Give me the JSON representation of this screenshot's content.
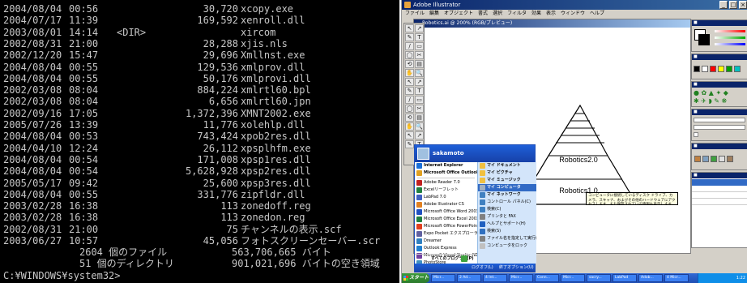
{
  "console": {
    "rows": [
      {
        "date": "2004/08/04",
        "time": "00:56",
        "size": "30,720",
        "name": "xcopy.exe"
      },
      {
        "date": "2004/07/17",
        "time": "11:39",
        "size": "169,592",
        "name": "xenroll.dll"
      },
      {
        "date": "2003/08/01",
        "time": "14:14",
        "dir": "<DIR>",
        "size": "",
        "name": "xircom"
      },
      {
        "date": "2002/08/31",
        "time": "21:00",
        "size": "28,288",
        "name": "xjis.nls"
      },
      {
        "date": "2002/12/20",
        "time": "15:47",
        "size": "29,696",
        "name": "Xmllnst.exe"
      },
      {
        "date": "2004/08/04",
        "time": "00:55",
        "size": "129,536",
        "name": "xmlprov.dll"
      },
      {
        "date": "2004/08/04",
        "time": "00:55",
        "size": "50,176",
        "name": "xmlprovi.dll"
      },
      {
        "date": "2002/03/08",
        "time": "08:04",
        "size": "884,224",
        "name": "xmlrtl60.bpl"
      },
      {
        "date": "2002/03/08",
        "time": "08:04",
        "size": "6,656",
        "name": "xmlrtl60.jpn"
      },
      {
        "date": "2002/09/16",
        "time": "17:05",
        "size": "1,372,396",
        "name": "XMNT2002.exe"
      },
      {
        "date": "2005/07/26",
        "time": "13:39",
        "size": "11,776",
        "name": "xolehlp.dll"
      },
      {
        "date": "2004/08/04",
        "time": "00:53",
        "size": "743,424",
        "name": "xpob2res.dll"
      },
      {
        "date": "2004/04/10",
        "time": "12:24",
        "size": "26,112",
        "name": "xpsplhfm.exe"
      },
      {
        "date": "2004/08/04",
        "time": "00:54",
        "size": "171,008",
        "name": "xpsp1res.dll"
      },
      {
        "date": "2004/08/04",
        "time": "00:54",
        "size": "5,628,928",
        "name": "xpsp2res.dll"
      },
      {
        "date": "2005/05/17",
        "time": "09:42",
        "size": "25,600",
        "name": "xpsp3res.dll"
      },
      {
        "date": "2004/08/04",
        "time": "00:55",
        "size": "331,776",
        "name": "zipfldr.dll"
      },
      {
        "date": "2003/02/28",
        "time": "16:38",
        "size": "113",
        "name": "zonedoff.reg"
      },
      {
        "date": "2003/02/28",
        "time": "16:38",
        "size": "113",
        "name": "zonedon.reg"
      },
      {
        "date": "2002/08/31",
        "time": "21:00",
        "size": "75",
        "name": "チャンネルの表示.scf"
      },
      {
        "date": "2003/06/27",
        "time": "10:57",
        "size": "45,056",
        "name": "フォトスクリーンセーバー.scr"
      }
    ],
    "summary": [
      {
        "count": "2604 個のファイル",
        "value": "563,706,665 バイト"
      },
      {
        "count": "51 個のディレクトリ",
        "value": "901,021,696 バイトの空き領域"
      }
    ],
    "prompt": "C:¥WINDOWS¥system32>"
  },
  "illustrator": {
    "window_title": "Adobe Illustrator",
    "menu": [
      "ファイル",
      "編集",
      "オブジェクト",
      "書式",
      "選択",
      "フィルタ",
      "効果",
      "表示",
      "ウィンドウ",
      "ヘルプ"
    ],
    "doc_title": "Robotics.ai @ 200% (RGB/プレビュー)",
    "pyramid_labels": [
      "Robotics2.0",
      "Robotics1.0"
    ],
    "tool_glyphs": [
      "↖",
      "↗",
      "✎",
      "T",
      "/",
      "▭",
      "◯",
      "✂",
      "⟲",
      "▤",
      "✋",
      "🔍"
    ],
    "swatch_colors": [
      "#000000",
      "#ffffff",
      "#ff0000",
      "#ffff00",
      "#00a000",
      "#00c0c0",
      "#0000ff",
      "#ff00ff",
      "#808080",
      "#c08040",
      "#a0c0e0",
      "#404040"
    ]
  },
  "start_menu": {
    "user": "sakamoto",
    "pinned": [
      {
        "label": "Internet Explorer",
        "color": "#1a6fd8"
      },
      {
        "label": "Microsoft Office Outlook",
        "color": "#e0a020"
      }
    ],
    "recent": [
      {
        "label": "Adobe Reader 7.0",
        "color": "#c02020"
      },
      {
        "label": "Excelリーフレット",
        "color": "#208040"
      },
      {
        "label": "LabPad 7.0",
        "color": "#4060c0"
      },
      {
        "label": "Adobe Illustrator CS",
        "color": "#e08020"
      },
      {
        "label": "Microsoft Office Word 2003",
        "color": "#2050c0"
      },
      {
        "label": "Microsoft Office Excel 2003",
        "color": "#208040"
      },
      {
        "label": "Microsoft Office PowerPoint 2003",
        "color": "#e04020"
      },
      {
        "label": "Expo Pocket エクスプローラ",
        "color": "#6060a0"
      },
      {
        "label": "Dreamer",
        "color": "#3080c0"
      },
      {
        "label": "Outlook Express",
        "color": "#2080d0"
      },
      {
        "label": "Microsoft Visual Studio .NET 2003",
        "color": "#7040a0"
      },
      {
        "label": "PhotoStore",
        "color": "#4090c0"
      }
    ],
    "all_programs": "すべてのプログラム(P)",
    "places": [
      {
        "label": "マイ ドキュメント",
        "color": "#f0c040"
      },
      {
        "label": "マイ ピクチャ",
        "color": "#f0c040"
      },
      {
        "label": "マイ ミュージック",
        "color": "#f0c040"
      },
      {
        "label": "マイ コンピュータ",
        "color": "#a0b0c0",
        "highlight": true
      },
      {
        "label": "マイ ネットワーク",
        "color": "#4080c0"
      },
      {
        "label": "コントロール パネル(C)",
        "color": "#4080c0"
      },
      {
        "label": "検索(C)",
        "color": "#4080c0"
      },
      {
        "label": "プリンタと FAX",
        "color": "#808080"
      },
      {
        "label": "ヘルプとサポート(H)",
        "color": "#2060c0"
      },
      {
        "label": "検索(S)",
        "color": "#3070c0"
      },
      {
        "label": "ファイル名を指定して実行(R)...",
        "color": "#808080"
      },
      {
        "label": "コンピュータをロック",
        "color": "#c0c0c0"
      }
    ],
    "logoff": "ログオフ(L)",
    "shutdown": "終了オプション(U)"
  },
  "tooltip": "コンピュータに接続しているディスク ドライブ、カメラ、スキャナ、およびその他のハードウェアにアクセスします。また保存されている情報も表示します。",
  "taskbar": {
    "start": "スタート",
    "tasks": [
      "Micr...",
      "2 Ad...",
      "4 Int...",
      "Micr...",
      "Conn...",
      "Micr...",
      "sacry...",
      "LabPad",
      "Adob...",
      "4 Micr..."
    ],
    "clock": "1:22"
  }
}
